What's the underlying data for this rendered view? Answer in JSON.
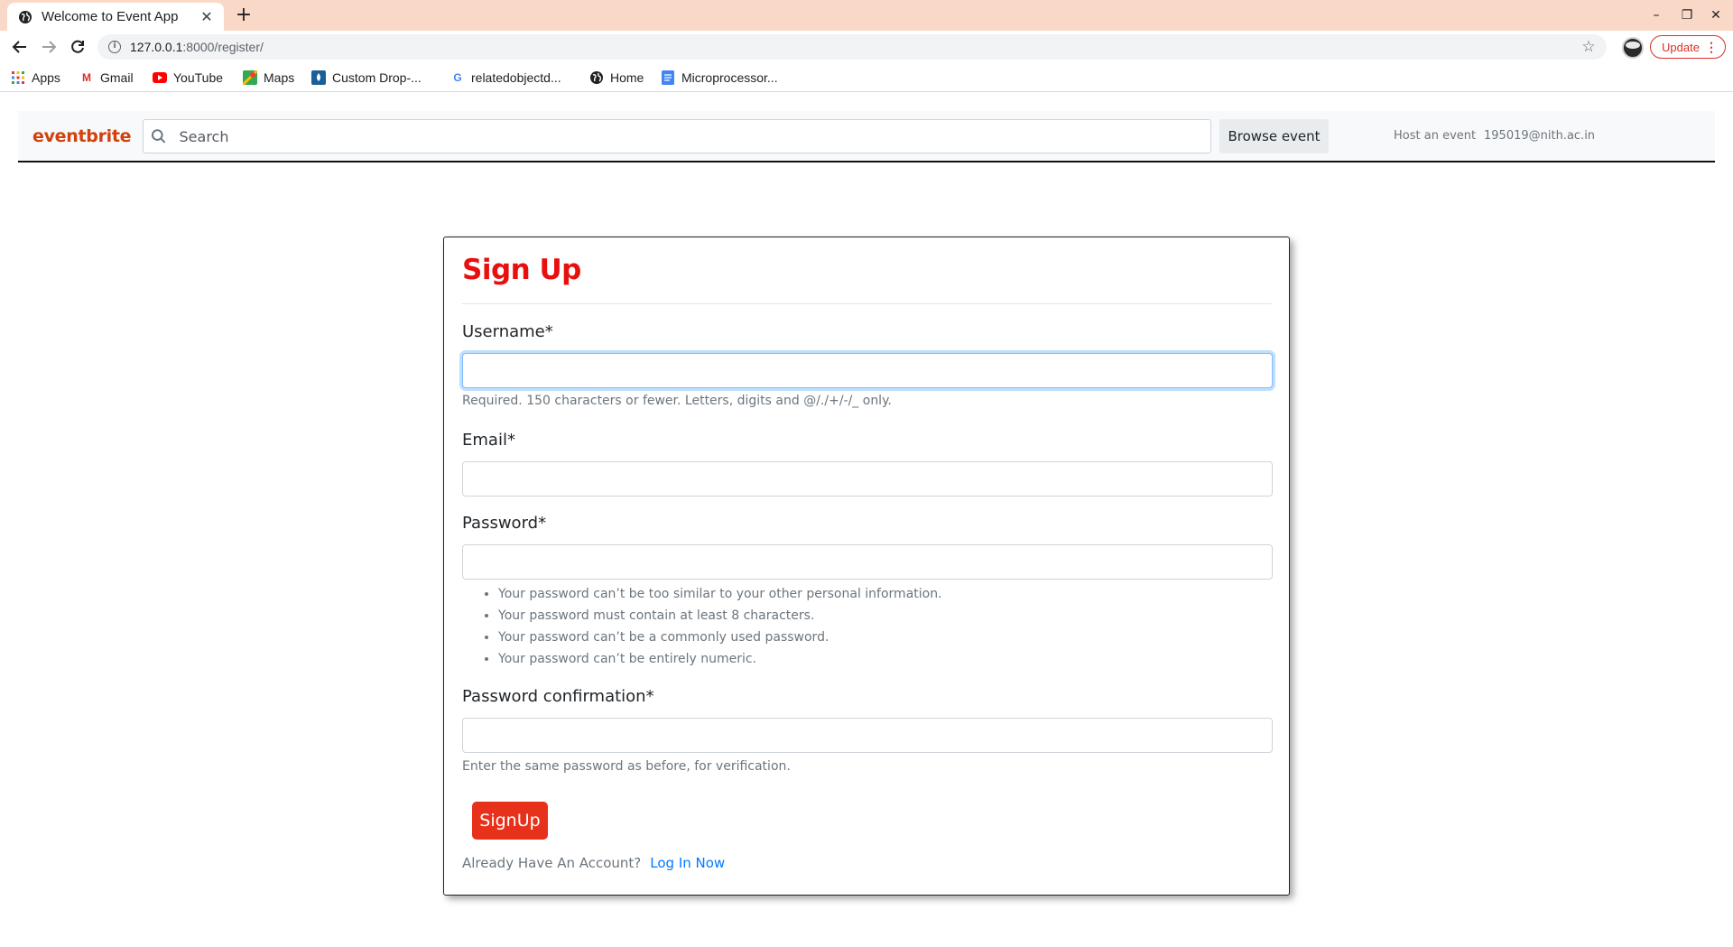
{
  "browser": {
    "tab_title": "Welcome to Event App",
    "url_host": "127.0.0.1",
    "url_rest": ":8000/register/",
    "update_label": "Update",
    "bookmarks": [
      {
        "label": "Apps",
        "icon": "apps-grid-icon"
      },
      {
        "label": "Gmail",
        "icon": "gmail-icon"
      },
      {
        "label": "YouTube",
        "icon": "youtube-icon"
      },
      {
        "label": "Maps",
        "icon": "maps-icon"
      },
      {
        "label": "Custom Drop-...",
        "icon": "custom-drop-icon"
      },
      {
        "label": "relatedobjectd...",
        "icon": "google-icon"
      },
      {
        "label": "Home",
        "icon": "globe-icon"
      },
      {
        "label": "Microprocessor...",
        "icon": "docs-icon"
      }
    ]
  },
  "site": {
    "brand": "eventbrite",
    "search_placeholder": "Search",
    "browse_label": "Browse event",
    "host_label": "Host an event",
    "user_email": "195019@nith.ac.in",
    "brand_color": "#d1410c"
  },
  "form": {
    "title": "Sign Up",
    "username_label": "Username*",
    "username_help": "Required. 150 characters or fewer. Letters, digits and @/./+/-/_ only.",
    "email_label": "Email*",
    "password_label": "Password*",
    "password_rules": [
      "Your password can’t be too similar to your other personal information.",
      "Your password must contain at least 8 characters.",
      "Your password can’t be a commonly used password.",
      "Your password can’t be entirely numeric."
    ],
    "confirm_label": "Password confirmation*",
    "confirm_help": "Enter the same password as before, for verification.",
    "submit_label": "SignUp",
    "account_prompt": "Already Have An Account?",
    "login_link": "Log In Now",
    "accent_color": "#e8100e"
  }
}
